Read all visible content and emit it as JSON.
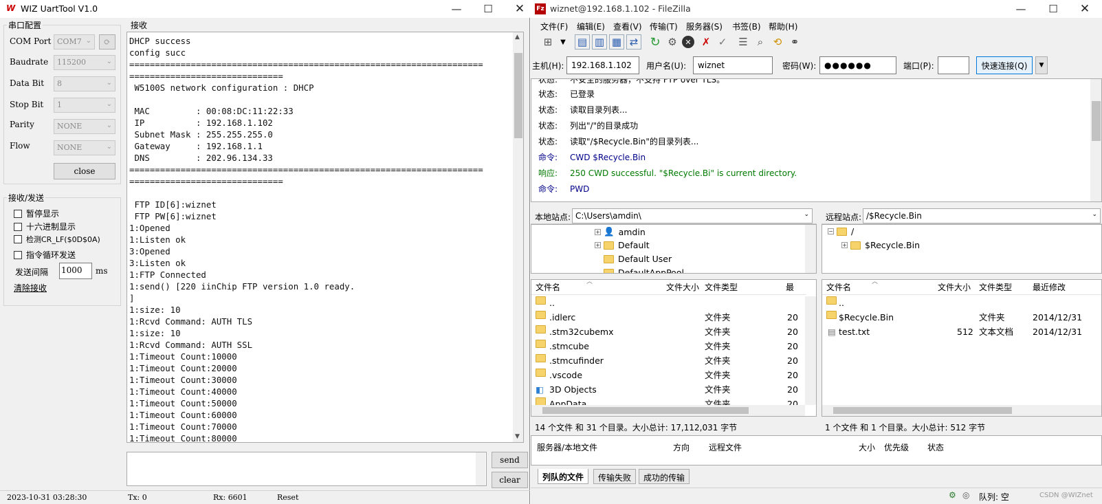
{
  "uart": {
    "title": "WIZ UartTool V1.0",
    "logo": "W",
    "serial_group": "串口配置",
    "fields": [
      {
        "label": "COM Port",
        "value": "COM7"
      },
      {
        "label": "Baudrate",
        "value": "115200"
      },
      {
        "label": "Data Bit",
        "value": "8"
      },
      {
        "label": "Stop Bit",
        "value": "1"
      },
      {
        "label": "Parity",
        "value": "NONE"
      },
      {
        "label": "Flow",
        "value": "NONE"
      }
    ],
    "refresh_glyph": "⟳",
    "close_label": "close",
    "send_group": "接收/发送",
    "checks": [
      "暂停显示",
      "十六进制显示",
      "检测CR_LF($0D$0A)",
      "指令循环发送"
    ],
    "interval_label": "发送间隔",
    "interval_value": "1000",
    "interval_unit": "ms",
    "clear_recv": "清除接收",
    "recv_group": "接收",
    "console_text": "DHCP success\nconfig succ\n=====================================================================\n==============================\n W5100S network configuration : DHCP\n\n MAC         : 00:08:DC:11:22:33\n IP          : 192.168.1.102\n Subnet Mask : 255.255.255.0\n Gateway     : 192.168.1.1\n DNS         : 202.96.134.33\n=====================================================================\n==============================\n\n FTP ID[6]:wiznet\n FTP PW[6]:wiznet\n1:Opened\n1:Listen ok\n3:Opened\n3:Listen ok\n1:FTP Connected\n1:send() [220 iinChip FTP version 1.0 ready.\n]\n1:size: 10\n1:Rcvd Command: AUTH TLS\n1:size: 10\n1:Rcvd Command: AUTH SSL\n1:Timeout Count:10000\n1:Timeout Count:20000\n1:Timeout Count:30000\n1:Timeout Count:40000\n1:Timeout Count:50000\n1:Timeout Count:60000\n1:Timeout Count:70000\n1:Timeout Count:80000",
    "send_label": "send",
    "clear_label": "clear",
    "status": {
      "time": "2023-10-31 03:28:30",
      "tx": "Tx: 0",
      "rx": "Rx: 6601",
      "reset": "Reset"
    }
  },
  "fz": {
    "title": "wiznet@192.168.1.102 - FileZilla",
    "app_logo": "Fz",
    "menu": [
      "文件(F)",
      "编辑(E)",
      "查看(V)",
      "传输(T)",
      "服务器(S)",
      "书签(B)",
      "帮助(H)"
    ],
    "quick": {
      "host_label": "主机(H):",
      "host": "192.168.1.102",
      "user_label": "用户名(U):",
      "user": "wiznet",
      "pass_label": "密码(W):",
      "pass": "●●●●●●",
      "port_label": "端口(P):",
      "port": "",
      "connect": "快速连接(Q)"
    },
    "log": [
      {
        "k": "状态:",
        "v": "不安全的服务器，不支持 FTP over TLS。",
        "c": "#000"
      },
      {
        "k": "状态:",
        "v": "已登录",
        "c": "#000"
      },
      {
        "k": "状态:",
        "v": "读取目录列表...",
        "c": "#000"
      },
      {
        "k": "状态:",
        "v": "列出\"/\"的目录成功",
        "c": "#000"
      },
      {
        "k": "状态:",
        "v": "读取\"/$Recycle.Bin\"的目录列表...",
        "c": "#000"
      },
      {
        "k": "命令:",
        "v": "CWD $Recycle.Bin",
        "c": "#00008b"
      },
      {
        "k": "响应:",
        "v": "250 CWD successful. \"$Recycle.Bi\" is current directory.",
        "c": "#007a00"
      },
      {
        "k": "命令:",
        "v": "PWD",
        "c": "#00008b"
      }
    ],
    "local": {
      "site_label": "本地站点:",
      "path": "C:\\Users\\amdin\\",
      "tree": [
        "amdin",
        "Default",
        "Default User",
        "DefaultAppPool"
      ],
      "cols": [
        "文件名",
        "文件大小",
        "文件类型",
        "最"
      ],
      "files": [
        {
          "name": "..",
          "size": "",
          "type": "",
          "mod": ""
        },
        {
          "name": ".idlerc",
          "size": "",
          "type": "文件夹",
          "mod": "20"
        },
        {
          "name": ".stm32cubemx",
          "size": "",
          "type": "文件夹",
          "mod": "20"
        },
        {
          "name": ".stmcube",
          "size": "",
          "type": "文件夹",
          "mod": "20"
        },
        {
          "name": ".stmcufinder",
          "size": "",
          "type": "文件夹",
          "mod": "20"
        },
        {
          "name": ".vscode",
          "size": "",
          "type": "文件夹",
          "mod": "20"
        },
        {
          "name": "3D Objects",
          "size": "",
          "type": "文件夹",
          "mod": "20"
        },
        {
          "name": "AppData",
          "size": "",
          "type": "文件夹",
          "mod": "20"
        }
      ],
      "summary": "14 个文件 和 31 个目录。大小总计: 17,112,031 字节"
    },
    "remote": {
      "site_label": "远程站点:",
      "path": "/$Recycle.Bin",
      "tree": [
        "/",
        "$Recycle.Bin"
      ],
      "cols": [
        "文件名",
        "文件大小",
        "文件类型",
        "最近修改"
      ],
      "files": [
        {
          "name": "..",
          "size": "",
          "type": "",
          "mod": ""
        },
        {
          "name": "$Recycle.Bin",
          "size": "",
          "type": "文件夹",
          "mod": "2014/12/31"
        },
        {
          "name": "test.txt",
          "size": "512",
          "type": "文本文档",
          "mod": "2014/12/31"
        }
      ],
      "summary": "1 个文件 和 1 个目录。大小总计: 512 字节"
    },
    "queue_cols": [
      "服务器/本地文件",
      "方向",
      "远程文件",
      "大小",
      "优先级",
      "状态"
    ],
    "tabs": [
      "列队的文件",
      "传输失败",
      "成功的传输"
    ],
    "queue_status": "队列: 空",
    "watermark": "CSDN @WIZnet"
  }
}
